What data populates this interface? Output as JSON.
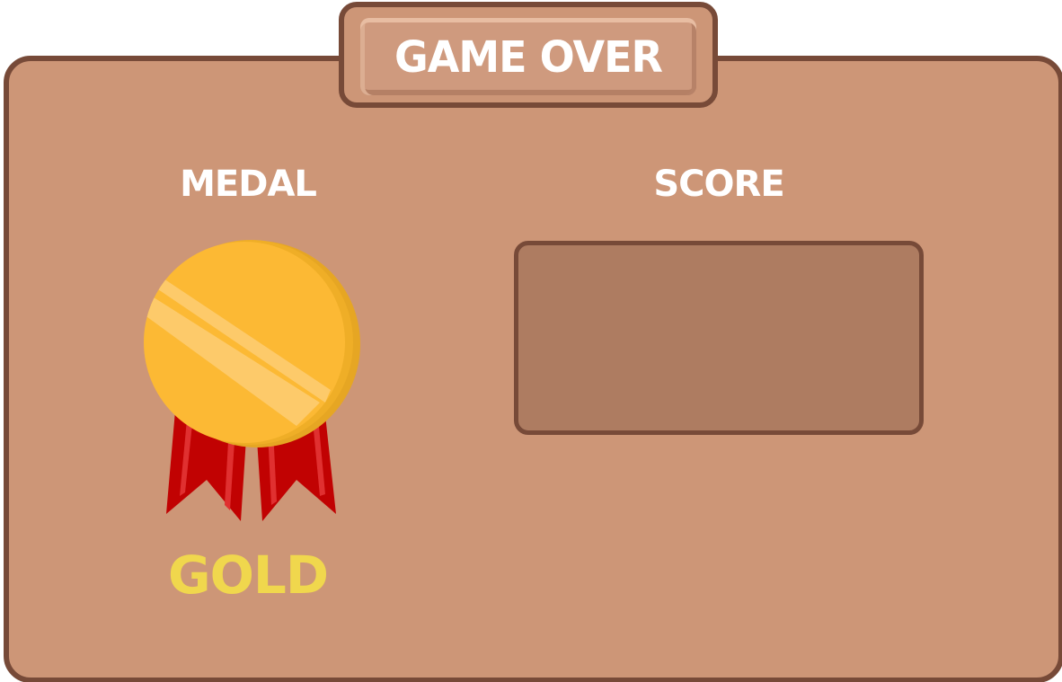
{
  "dialog": {
    "title": "GAME OVER",
    "medal_label": "MEDAL",
    "score_label": "SCORE",
    "score_value": "",
    "medal_name": "GOLD",
    "medal_icon": "gold-medal-icon"
  },
  "colors": {
    "panel": "#cd9677",
    "border": "#774a38",
    "score_box": "#ae7c61",
    "medal_gold": "#fcb934",
    "ribbon_red": "#c10202",
    "medal_text": "#f0d74d",
    "label_text": "#ffffff"
  }
}
